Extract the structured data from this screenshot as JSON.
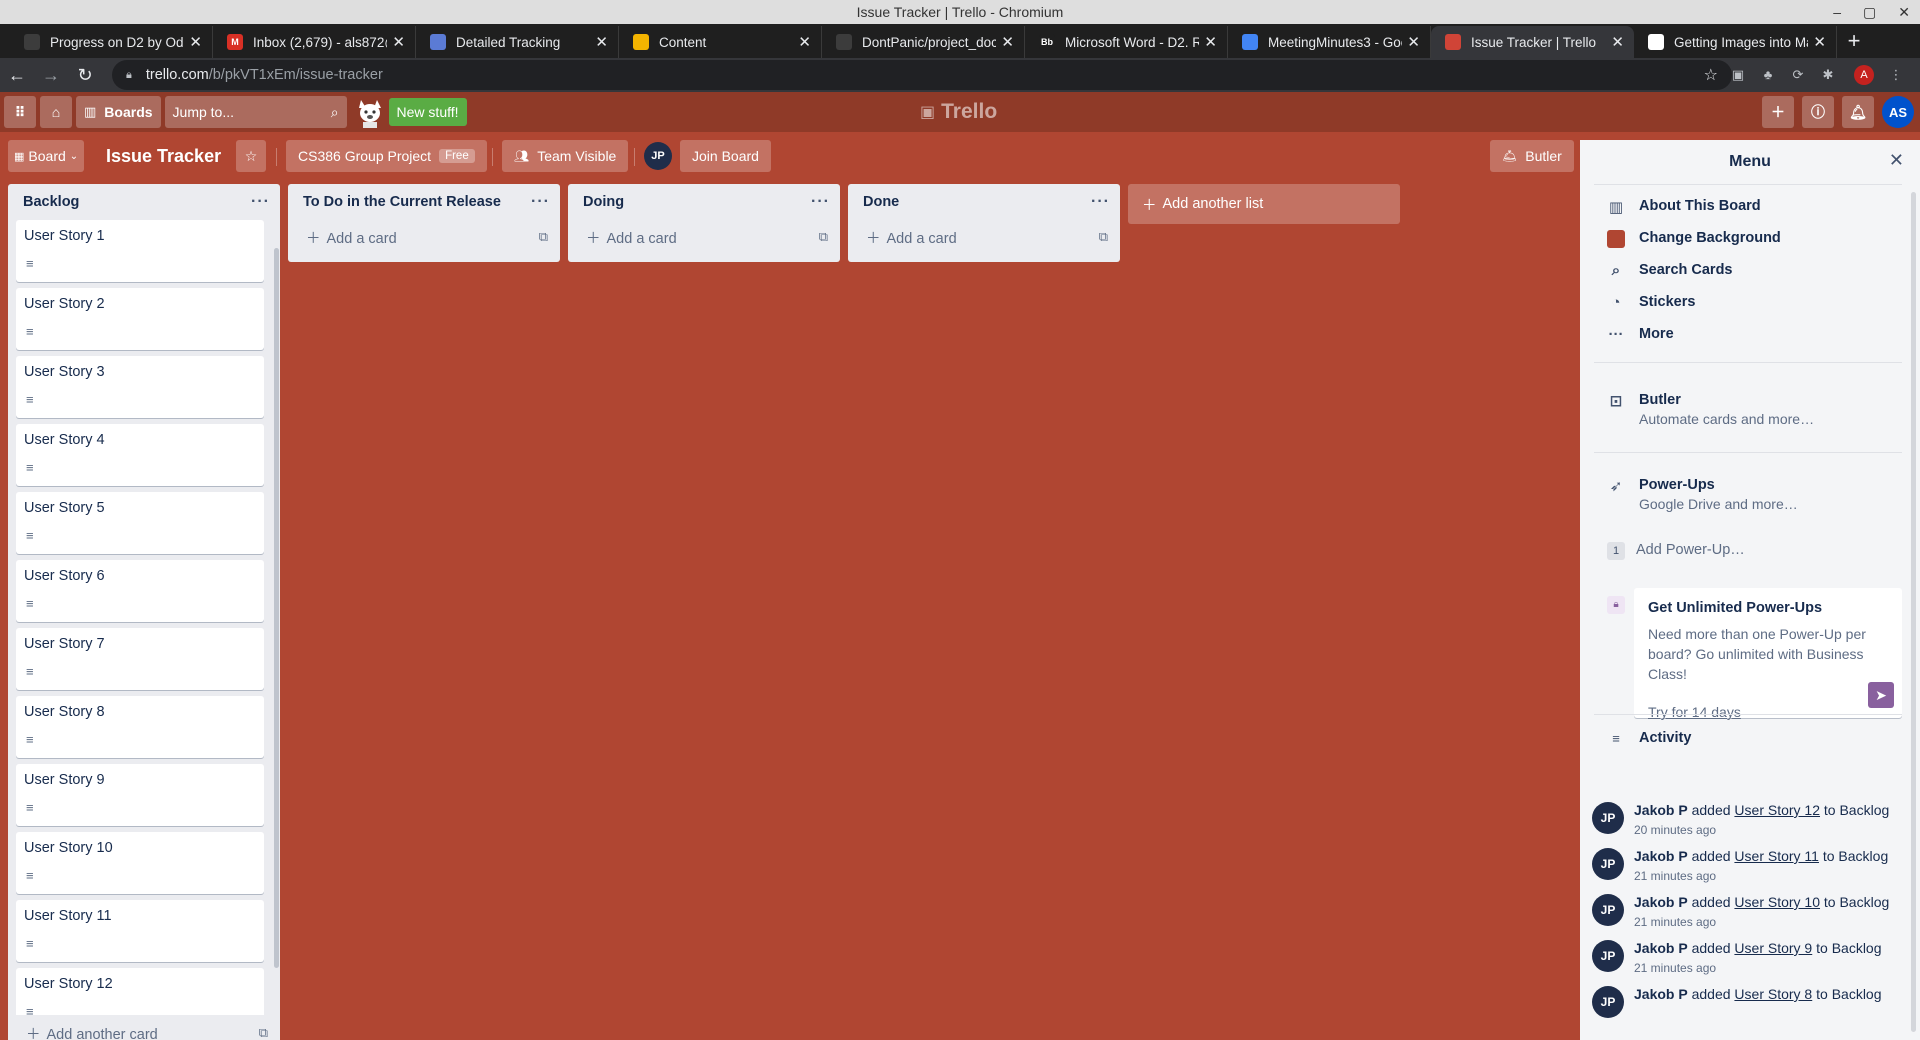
{
  "window": {
    "title": "Issue Tracker | Trello - Chromium"
  },
  "tabs": [
    {
      "label": "Progress on D2 by Odd",
      "favicon_color": "#3c3c3c",
      "favicon_text": ""
    },
    {
      "label": "Inbox (2,679) - als872@",
      "favicon_color": "#d93025",
      "favicon_text": "M"
    },
    {
      "label": "Detailed Tracking",
      "favicon_color": "#5b7bd5",
      "favicon_text": ""
    },
    {
      "label": "Content",
      "favicon_color": "#f4b400",
      "favicon_text": ""
    },
    {
      "label": "DontPanic/project_doc",
      "favicon_color": "#3c3c3c",
      "favicon_text": ""
    },
    {
      "label": "Microsoft Word - D2. Re",
      "favicon_color": "#1f1f1f",
      "favicon_text": "Bb"
    },
    {
      "label": "MeetingMinutes3 - Goo",
      "favicon_color": "#4285f4",
      "favicon_text": ""
    },
    {
      "label": "Issue Tracker | Trello",
      "favicon_color": "#d04437",
      "favicon_text": ""
    },
    {
      "label": "Getting Images into Ma",
      "favicon_color": "#ffffff",
      "favicon_text": ""
    }
  ],
  "address": {
    "host": "trello.com",
    "path": "/b/pkVT1xEm/issue-tracker"
  },
  "header": {
    "boards_label": "Boards",
    "jump_placeholder": "Jump to...",
    "new_stuff": "New stuff!",
    "logo": "Trello",
    "user_initials": "AS"
  },
  "board": {
    "view_label": "Board",
    "name": "Issue Tracker",
    "team": "CS386 Group Project",
    "team_badge": "Free",
    "visibility": "Team Visible",
    "member_initials": "JP",
    "join": "Join Board",
    "butler": "Butler"
  },
  "lists": [
    {
      "title": "Backlog",
      "cards": [
        "User Story 1",
        "User Story 2",
        "User Story 3",
        "User Story 4",
        "User Story 5",
        "User Story 6",
        "User Story 7",
        "User Story 8",
        "User Story 9",
        "User Story 10",
        "User Story 11",
        "User Story 12"
      ],
      "add": "Add another card"
    },
    {
      "title": "To Do in the Current Release",
      "cards": [],
      "add": "Add a card"
    },
    {
      "title": "Doing",
      "cards": [],
      "add": "Add a card"
    },
    {
      "title": "Done",
      "cards": [],
      "add": "Add a card"
    }
  ],
  "add_list": "Add another list",
  "menu": {
    "title": "Menu",
    "items": [
      {
        "label": "About This Board"
      },
      {
        "label": "Change Background"
      },
      {
        "label": "Search Cards"
      },
      {
        "label": "Stickers"
      },
      {
        "label": "More"
      }
    ],
    "butler": {
      "label": "Butler",
      "sub": "Automate cards and more…"
    },
    "powerups": {
      "label": "Power-Ups",
      "sub": "Google Drive and more…",
      "count": "1",
      "add": "Add Power-Up…"
    },
    "promo": {
      "title": "Get Unlimited Power-Ups",
      "body": "Need more than one Power-Up per board? Go unlimited with Business Class!",
      "link": "Try for 14 days"
    },
    "activity": {
      "label": "Activity",
      "entries": [
        {
          "user": "Jakob P",
          "initials": "JP",
          "verb": "added",
          "card": "User Story 12",
          "tail": "to Backlog",
          "time": "20 minutes ago"
        },
        {
          "user": "Jakob P",
          "initials": "JP",
          "verb": "added",
          "card": "User Story 11",
          "tail": "to Backlog",
          "time": "21 minutes ago"
        },
        {
          "user": "Jakob P",
          "initials": "JP",
          "verb": "added",
          "card": "User Story 10",
          "tail": "to Backlog",
          "time": "21 minutes ago"
        },
        {
          "user": "Jakob P",
          "initials": "JP",
          "verb": "added",
          "card": "User Story 9",
          "tail": "to Backlog",
          "time": "21 minutes ago"
        },
        {
          "user": "Jakob P",
          "initials": "JP",
          "verb": "added",
          "card": "User Story 8",
          "tail": "to Backlog",
          "time": ""
        }
      ]
    }
  }
}
